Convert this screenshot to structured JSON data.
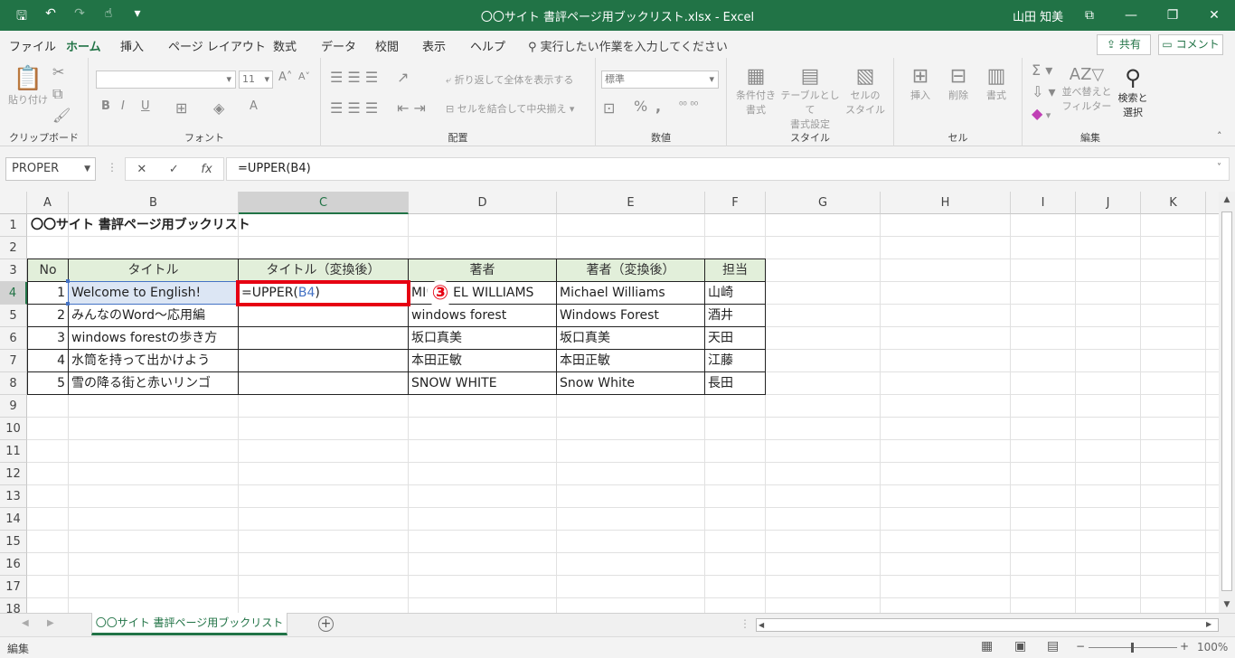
{
  "titlebar": {
    "title": "〇〇サイト 書評ページ用ブックリスト.xlsx  -  Excel",
    "user": "山田 知美",
    "save_icon": "save-icon",
    "undo_icon": "undo-icon",
    "redo_icon": "redo-icon",
    "touch_icon": "touch-mode-icon"
  },
  "menu": {
    "tabs": [
      "ファイル",
      "ホーム",
      "挿入",
      "ページ レイアウト",
      "数式",
      "データ",
      "校閲",
      "表示",
      "ヘルプ"
    ],
    "active_tab": "ホーム",
    "tell_me": "実行したい作業を入力してください",
    "share": "共有",
    "comment": "コメント"
  },
  "ribbon": {
    "clipboard": {
      "label": "クリップボード",
      "paste": "貼り付け"
    },
    "font": {
      "label": "フォント",
      "size": "11"
    },
    "alignment": {
      "label": "配置",
      "wrap": "折り返して全体を表示する",
      "merge": "セルを結合して中央揃え"
    },
    "number": {
      "label": "数値",
      "format": "標準"
    },
    "styles": {
      "label": "スタイル",
      "conditional": "条件付き\n書式",
      "table": "テーブルとして\n書式設定",
      "cellstyle": "セルの\nスタイル"
    },
    "cells": {
      "label": "セル",
      "insert": "挿入",
      "delete": "削除",
      "format": "書式"
    },
    "editing": {
      "label": "編集",
      "sort": "並べ替えと\nフィルター",
      "find": "検索と\n選択"
    }
  },
  "formula_bar": {
    "name_box": "PROPER",
    "formula": "=UPPER(B4)"
  },
  "columns": [
    "A",
    "B",
    "C",
    "D",
    "E",
    "F",
    "G",
    "H",
    "I",
    "J",
    "K"
  ],
  "rows": [
    "1",
    "2",
    "3",
    "4",
    "5",
    "6",
    "7",
    "8",
    "9",
    "10",
    "11",
    "12",
    "13",
    "14",
    "15",
    "16",
    "17",
    "18"
  ],
  "sheet": {
    "title": "〇〇サイト 書評ページ用ブックリスト",
    "headers": [
      "No",
      "タイトル",
      "タイトル（変換後）",
      "著者",
      "著者（変換後）",
      "担当"
    ],
    "data": [
      [
        "1",
        "Welcome to English!",
        "",
        "MICHAEL WILLIAMS",
        "Michael Williams",
        "山崎"
      ],
      [
        "2",
        "みんなのWord～応用編",
        "",
        "windows forest",
        "Windows Forest",
        "酒井"
      ],
      [
        "3",
        "windows forestの歩き方",
        "",
        "坂口真美",
        "坂口真美",
        "天田"
      ],
      [
        "4",
        "水筒を持って出かけよう",
        "",
        "本田正敏",
        "本田正敏",
        "江藤"
      ],
      [
        "5",
        "雪の降る街と赤いリンゴ",
        "",
        "SNOW WHITE",
        "Snow White",
        "長田"
      ]
    ],
    "editing_cell": {
      "prefix": "=UPPER(",
      "ref": "B4",
      "suffix": ")"
    },
    "step_marker": "③"
  },
  "sheet_tab": "〇〇サイト 書評ページ用ブックリスト",
  "status": {
    "mode": "編集",
    "zoom": "100%"
  },
  "colors": {
    "excel_green": "#217346",
    "header_fill": "#e2efda",
    "highlight_red": "#e60012",
    "ref_blue": "#4472c4"
  }
}
